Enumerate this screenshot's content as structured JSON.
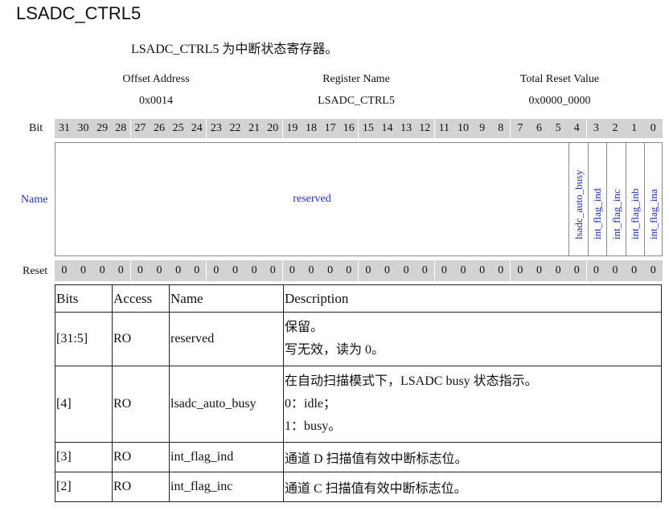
{
  "title": "LSADC_CTRL5",
  "intro": "LSADC_CTRL5 为中断状态寄存器。",
  "header": {
    "offset_label": "Offset Address",
    "offset_value": "0x0014",
    "regname_label": "Register Name",
    "regname_value": "LSADC_CTRL5",
    "reset_label": "Total Reset Value",
    "reset_value": "0x0000_0000"
  },
  "diagram": {
    "bit_label": "Bit",
    "name_label": "Name",
    "reset_label": "Reset",
    "bits": [
      "31",
      "30",
      "29",
      "28",
      "27",
      "26",
      "25",
      "24",
      "23",
      "22",
      "21",
      "20",
      "19",
      "18",
      "17",
      "16",
      "15",
      "14",
      "13",
      "12",
      "11",
      "10",
      "9",
      "8",
      "7",
      "6",
      "5",
      "4",
      "3",
      "2",
      "1",
      "0"
    ],
    "resets": [
      "0",
      "0",
      "0",
      "0",
      "0",
      "0",
      "0",
      "0",
      "0",
      "0",
      "0",
      "0",
      "0",
      "0",
      "0",
      "0",
      "0",
      "0",
      "0",
      "0",
      "0",
      "0",
      "0",
      "0",
      "0",
      "0",
      "0",
      "0",
      "0",
      "0",
      "0",
      "0"
    ],
    "fields": [
      "reserved",
      "lsadc_auto_busy",
      "int_flag_ind",
      "int_flag_inc",
      "int_flag_inb",
      "int_flag_ina"
    ],
    "field_color": "#2030c0"
  },
  "table": {
    "headers": [
      "Bits",
      "Access",
      "Name",
      "Description"
    ],
    "rows": [
      {
        "bits": "[31:5]",
        "access": "RO",
        "name": "reserved",
        "desc": [
          "保留。",
          "写无效，读为 0。"
        ]
      },
      {
        "bits": "[4]",
        "access": "RO",
        "name": "lsadc_auto_busy",
        "desc": [
          "在自动扫描模式下，LSADC busy 状态指示。",
          "0：idle；",
          "1：busy。"
        ]
      },
      {
        "bits": "[3]",
        "access": "RO",
        "name": "int_flag_ind",
        "desc": [
          "通道 D 扫描值有效中断标志位。"
        ]
      },
      {
        "bits": "[2]",
        "access": "RO",
        "name": "int_flag_inc",
        "desc": [
          "通道 C 扫描值有效中断标志位。"
        ]
      }
    ]
  }
}
